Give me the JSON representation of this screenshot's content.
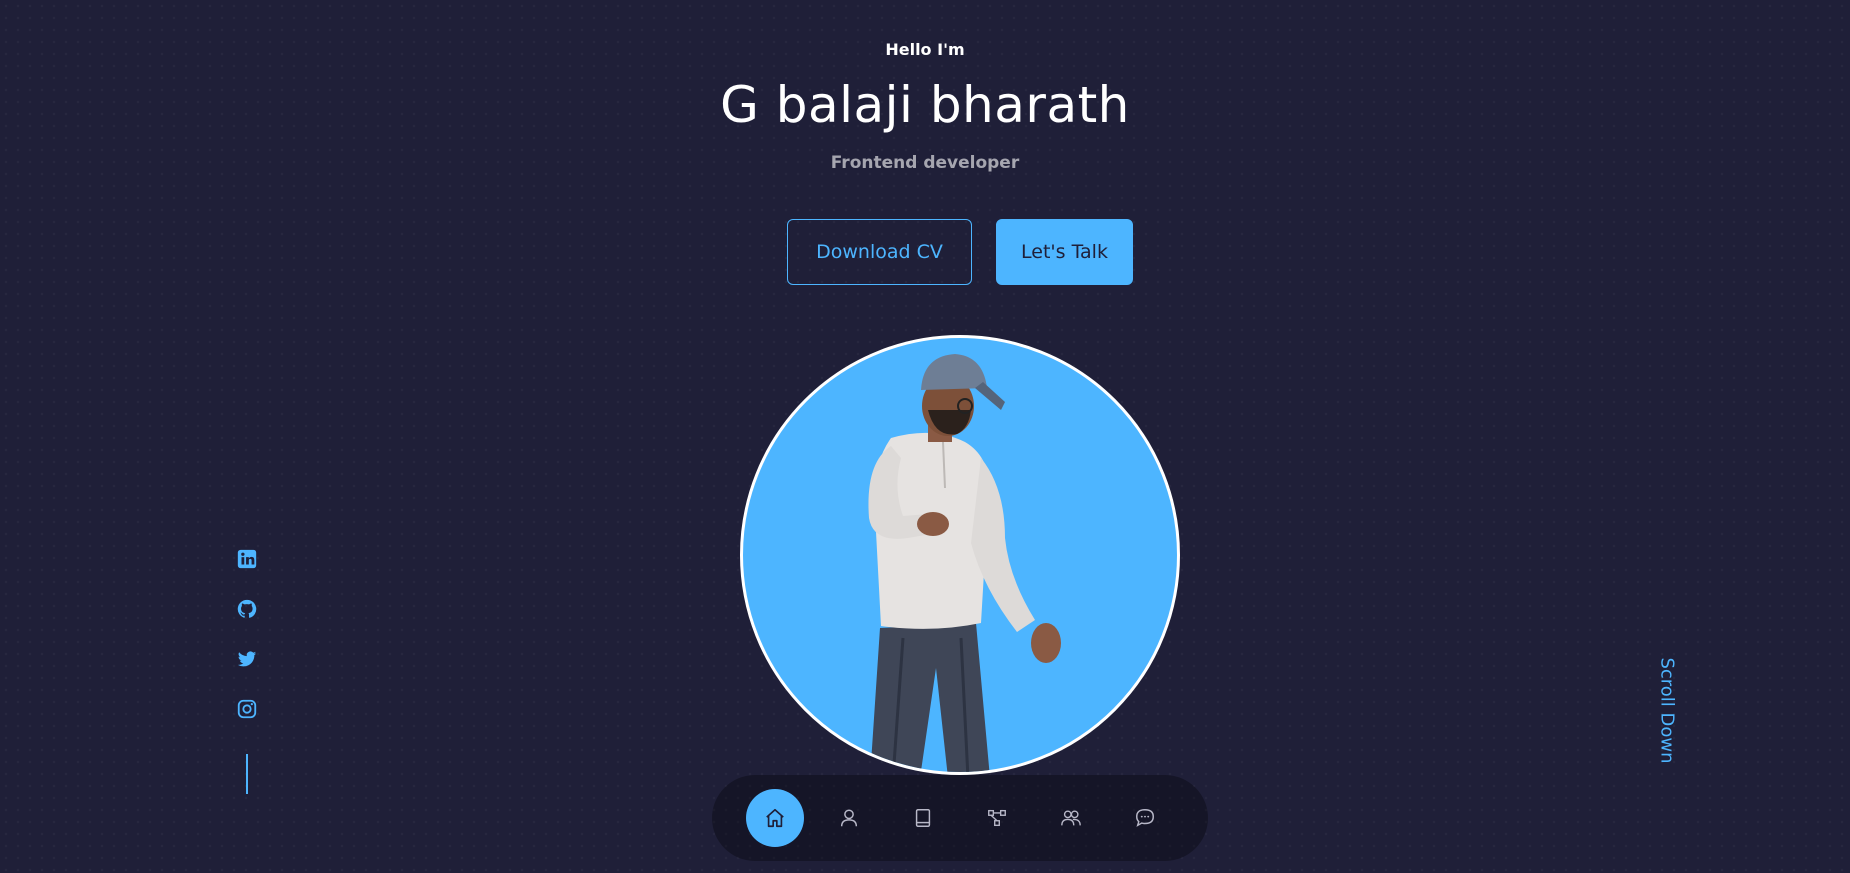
{
  "header": {
    "greeting": "Hello I'm",
    "name": "G balaji bharath",
    "role": "Frontend developer"
  },
  "cta": {
    "download_label": "Download CV",
    "talk_label": "Let's Talk"
  },
  "socials": [
    {
      "icon": "linkedin-icon"
    },
    {
      "icon": "github-icon"
    },
    {
      "icon": "twitter-icon"
    },
    {
      "icon": "instagram-icon"
    }
  ],
  "scroll": {
    "label": "Scroll Down"
  },
  "nav": {
    "items": [
      {
        "icon": "home-icon",
        "active": true
      },
      {
        "icon": "user-icon",
        "active": false
      },
      {
        "icon": "book-icon",
        "active": false
      },
      {
        "icon": "services-icon",
        "active": false
      },
      {
        "icon": "users-icon",
        "active": false
      },
      {
        "icon": "message-icon",
        "active": false
      }
    ]
  },
  "colors": {
    "background": "#1f1f38",
    "primary": "#4db5ff",
    "white": "#ffffff"
  }
}
